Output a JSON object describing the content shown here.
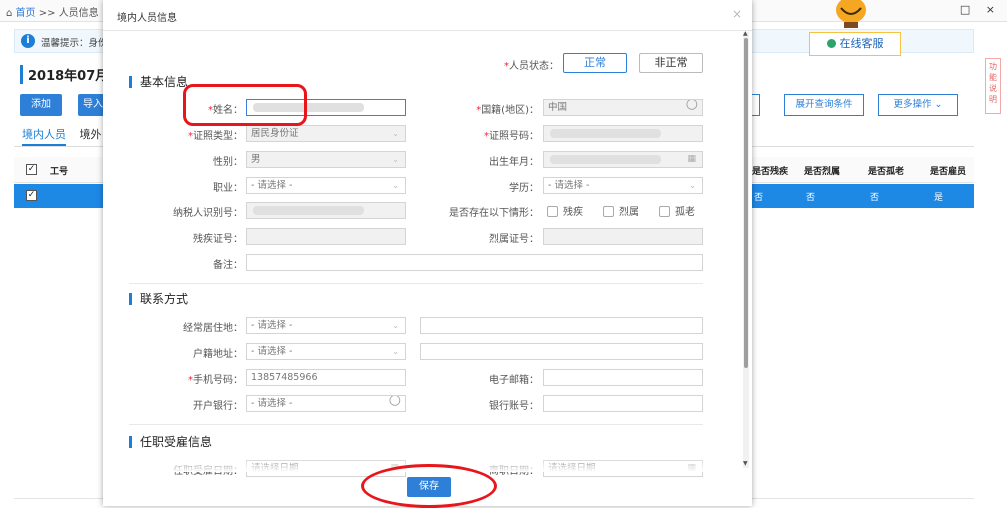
{
  "background": {
    "breadcrumb": {
      "home": "首页",
      "sep": ">>",
      "current": "人员信息"
    },
    "window_controls": "□ ×",
    "notice": "温馨提示：身份",
    "service_label": "在线客服",
    "period": "2018年07月",
    "toolbar": {
      "add": "添加",
      "import": "导入",
      "expand": "展开查询条件",
      "more": "更多操作"
    },
    "tabs": [
      "境内人员",
      "境外"
    ],
    "table": {
      "headers": [
        "工号",
        "是否残疾",
        "是否烈属",
        "是否孤老",
        "是否雇员"
      ],
      "row": [
        "否",
        "否",
        "否",
        "是"
      ]
    },
    "side_help": "功能说明"
  },
  "modal": {
    "title": "境内人员信息",
    "status": {
      "label": "人员状态：",
      "normal": "正常",
      "abnormal": "非正常"
    },
    "sections": {
      "basic": "基本信息",
      "contact": "联系方式",
      "employment": "任职受雇信息"
    },
    "fields": {
      "name": {
        "label": "姓名：",
        "value": ""
      },
      "nationality": {
        "label": "国籍(地区)：",
        "value": "中国"
      },
      "id_type": {
        "label": "证照类型：",
        "value": "居民身份证"
      },
      "id_number": {
        "label": "证照号码：",
        "value": ""
      },
      "gender": {
        "label": "性别：",
        "value": "男"
      },
      "birth": {
        "label": "出生年月：",
        "value": ""
      },
      "occupation": {
        "label": "职业：",
        "value": "- 请选择 -"
      },
      "education": {
        "label": "学历：",
        "value": "- 请选择 -"
      },
      "taxpayer_id": {
        "label": "纳税人识别号：",
        "value": ""
      },
      "situation": {
        "label": "是否存在以下情形：",
        "options": [
          "残疾",
          "烈属",
          "孤老"
        ]
      },
      "disability_no": {
        "label": "残疾证号：",
        "value": ""
      },
      "martyr_no": {
        "label": "烈属证号：",
        "value": ""
      },
      "remark": {
        "label": "备注：",
        "value": ""
      },
      "residence": {
        "label": "经常居住地：",
        "value": "- 请选择 -"
      },
      "household": {
        "label": "户籍地址：",
        "value": "- 请选择 -"
      },
      "phone": {
        "label": "手机号码：",
        "value": "13857485966"
      },
      "email": {
        "label": "电子邮箱：",
        "value": ""
      },
      "bank": {
        "label": "开户银行：",
        "value": "- 请选择 -"
      },
      "account": {
        "label": "银行账号：",
        "value": ""
      },
      "hire_date": {
        "label": "任职受雇日期：",
        "value": "请选择日期"
      },
      "leave_date": {
        "label": "离职日期：",
        "value": "请选择日期"
      }
    },
    "save": "保存"
  },
  "colors": {
    "accent": "#2e7fd8",
    "highlight": "#e8161b",
    "selected_row": "#1e88e5"
  }
}
